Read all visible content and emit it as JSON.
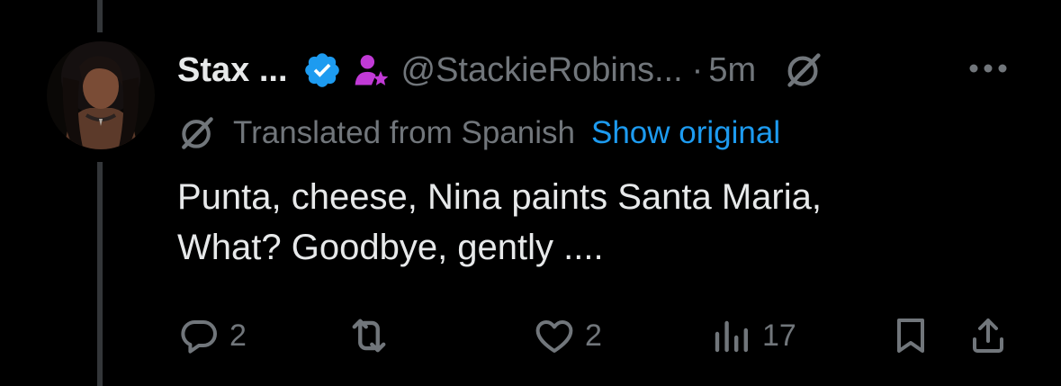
{
  "post": {
    "author_name": "Stax ...",
    "handle": "@StackieRobins...",
    "separator": "·",
    "timestamp": "5m",
    "translation_label": "Translated from Spanish",
    "show_original_label": "Show original",
    "text_lines": [
      "Punta, cheese, Nina paints Santa Maria,",
      "What? Goodbye, gently ...."
    ]
  },
  "actions": {
    "replies": "2",
    "likes": "2",
    "views": "17"
  },
  "icons": {
    "verified": "verified-badge-icon",
    "affiliate": "affiliate-badge-icon",
    "grok": "grok-icon",
    "more": "more-icon",
    "translate": "translate-icon",
    "reply": "reply-icon",
    "repost": "repost-icon",
    "like": "heart-icon",
    "views": "views-icon",
    "bookmark": "bookmark-icon",
    "share": "share-icon"
  },
  "colors": {
    "background": "#000000",
    "text_primary": "#e7e9ea",
    "text_secondary": "#71767b",
    "link": "#1d9bf0",
    "verified": "#1d9bf0",
    "affiliate": "#c13ad6",
    "thread_line": "#333639"
  }
}
